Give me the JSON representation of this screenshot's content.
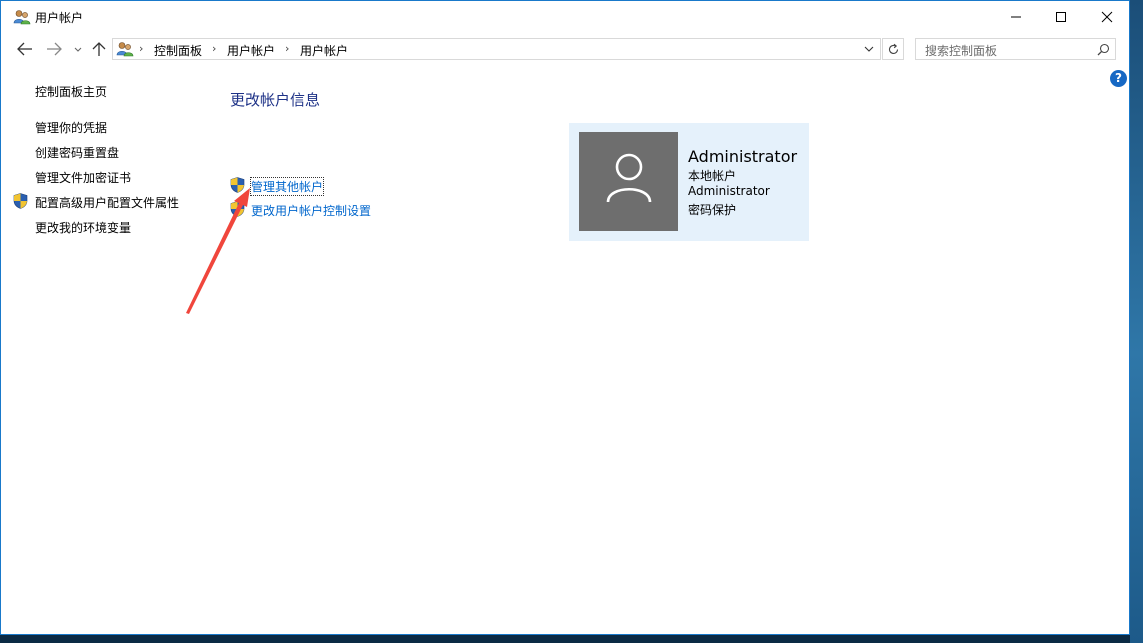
{
  "window": {
    "title": "用户帐户"
  },
  "address": {
    "crumbs": [
      "控制面板",
      "用户帐户",
      "用户帐户"
    ]
  },
  "search": {
    "placeholder": "搜索控制面板"
  },
  "help": {
    "label": "?"
  },
  "sidebar": {
    "items": [
      {
        "label": "控制面板主页"
      },
      {
        "label": "管理你的凭据"
      },
      {
        "label": "创建密码重置盘"
      },
      {
        "label": "管理文件加密证书"
      },
      {
        "label": "配置高级用户配置文件属性",
        "shield": true
      },
      {
        "label": "更改我的环境变量"
      }
    ]
  },
  "main": {
    "title": "更改帐户信息",
    "tasks": [
      {
        "label": "管理其他帐户",
        "shield": true
      },
      {
        "label": "更改用户帐户控制设置",
        "shield": true
      }
    ]
  },
  "account": {
    "name": "Administrator",
    "lines": [
      "本地帐户",
      "Administrator",
      "密码保护"
    ]
  },
  "colors": {
    "link": "#0066cc",
    "title": "#1e3287",
    "card": "#e5f1fb",
    "avatar": "#6e6e6e",
    "annotation_arrow": "#f0463c"
  }
}
